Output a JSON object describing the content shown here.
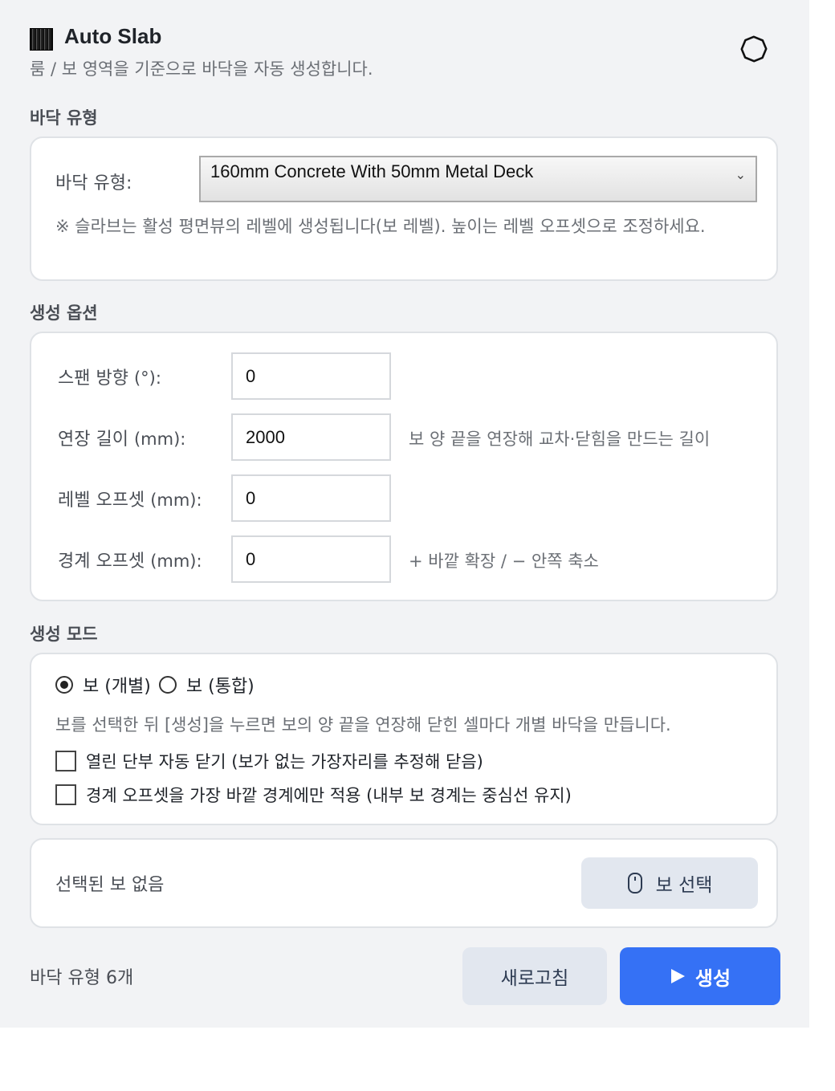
{
  "header": {
    "title": "Auto Slab",
    "subtitle": "룸 / 보 영역을 기준으로 바닥을 자동 생성합니다.",
    "settings_icon": "gear-icon",
    "app_icon": "slab-hatch-icon"
  },
  "floor_type_section": {
    "heading": "바닥 유형",
    "label": "바닥 유형:",
    "selected": "160mm Concrete With 50mm Metal Deck",
    "note": "※ 슬라브는 활성 평면뷰의 레벨에 생성됩니다(보 레벨). 높이는 레벨 오프셋으로 조정하세요."
  },
  "options_section": {
    "heading": "생성 옵션",
    "fields": [
      {
        "label": "스팬 방향",
        "unit": "(°):",
        "value": "0",
        "hint": ""
      },
      {
        "label": "연장 길이",
        "unit": "(mm):",
        "value": "2000",
        "hint": "보 양 끝을 연장해 교차·닫힘을 만드는 길이"
      },
      {
        "label": "레벨 오프셋",
        "unit": "(mm):",
        "value": "0",
        "hint": ""
      },
      {
        "label": "경계 오프셋",
        "unit": "(mm):",
        "value": "0",
        "hint": "+ 바깥 확장 / − 안쪽 축소"
      }
    ]
  },
  "mode_section": {
    "heading": "생성 모드",
    "radio_individual": "보 (개별)",
    "radio_combined": "보 (통합)",
    "selected_mode": "individual",
    "description": "보를 선택한 뒤 [생성]을 누르면 보의 양 끝을 연장해 닫힌 셀마다 개별 바닥을 만듭니다.",
    "check_auto_close": "열린 단부 자동 닫기 (보가 없는 가장자리를 추정해 닫음)",
    "check_outer_only": "경계 오프셋을 가장 바깥 경계에만 적용 (내부 보 경계는 중심선 유지)"
  },
  "selection": {
    "status": "선택된 보 없음",
    "button_label": "보 선택",
    "button_icon": "mouse-icon"
  },
  "footer": {
    "count": "바닥 유형 6개",
    "refresh_label": "새로고침",
    "generate_label": "생성",
    "generate_icon": "play-icon"
  },
  "colors": {
    "accent": "#3571f5",
    "secondary_button": "#e2e7ef",
    "panel_bg": "#f2f3f5"
  }
}
